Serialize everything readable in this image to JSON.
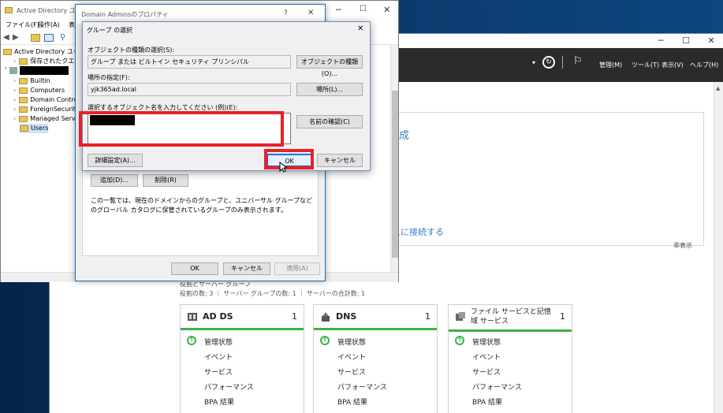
{
  "server_manager": {
    "menus": [
      "管理(M)",
      "ツール(T)",
      "表示(V)",
      "ヘルプ(H)"
    ],
    "welcome_partial_1": "成",
    "welcome_partial_2": "スに接続する",
    "hide_label": "非表示",
    "roles_heading_partial": "役割とサーバー グループ",
    "roles_summary": "役割の数: 3 ｜ サーバー グループの数: 1 ｜ サーバーの合計数: 1",
    "tiles": [
      {
        "name": "AD DS",
        "count": "1",
        "items": [
          "管理状態",
          "イベント",
          "サービス",
          "パフォーマンス",
          "BPA 結果"
        ]
      },
      {
        "name": "DNS",
        "count": "1",
        "items": [
          "管理状態",
          "イベント",
          "サービス",
          "パフォーマンス",
          "BPA 結果"
        ]
      },
      {
        "name": "ファイル サービスと記憶域 サービス",
        "count": "1",
        "items": [
          "管理状態",
          "イベント",
          "サービス",
          "パフォーマンス",
          "BPA 結果"
        ]
      }
    ],
    "accent_color": "#3db14a"
  },
  "aduc": {
    "title": "Active Directory ユーザー",
    "menu": [
      "ファイル(F)",
      "操作(A)",
      "表"
    ],
    "tree": {
      "root": "Active Directory ユーザー",
      "saved_queries": "保存されたクエリ",
      "children": [
        "Builtin",
        "Computers",
        "Domain Contro",
        "ForeignSecurity",
        "Managed Servic",
        "Users"
      ]
    }
  },
  "props_dialog": {
    "title": "Domain Adminsのプロパティ",
    "title_buttons": [
      "?",
      "✕"
    ],
    "add_button": "追加(D)...",
    "remove_button": "削除(R)",
    "info_text": "この一覧では、現在のドメインからのグループと、ユニバーサル グループなどのグローバル カタログに保管されているグループのみ表示されます。",
    "ok": "OK",
    "cancel": "キャンセル",
    "apply": "適用(A)"
  },
  "group_select_dialog": {
    "title": "グループ の選択",
    "object_type_label": "オブジェクトの種類の選択(S):",
    "object_type_value": "グループ または ビルトイン セキュリティ プリンシパル",
    "object_type_button": "オブジェクトの種類(O)...",
    "location_label": "場所の指定(F):",
    "location_value": "yjk365ad.local",
    "location_button": "場所(L)...",
    "names_label": "選択するオブジェクト名を入力してください (例)(E):",
    "check_names_button": "名前の確認(C)",
    "advanced_button": "詳細設定(A)...",
    "ok": "OK",
    "cancel": "キャンセル",
    "highlight_color": "#e8202a"
  }
}
